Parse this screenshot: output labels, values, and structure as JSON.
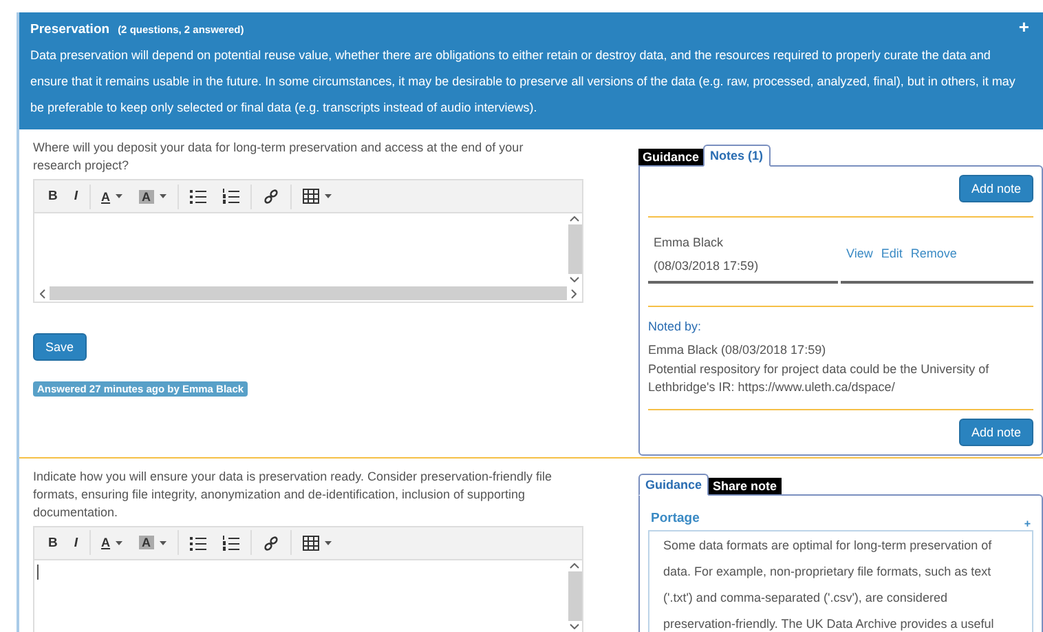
{
  "section": {
    "title": "Preservation",
    "subtitle": "(2 questions, 2 answered)",
    "expander": "+",
    "description": "Data preservation will depend on potential reuse value, whether there are obligations to either retain or destroy data, and the resources required to properly curate the data and ensure that it remains usable in the future. In some circumstances, it may be desirable to preserve all versions of the data (e.g. raw, processed, analyzed, final), but in others, it may be preferable to keep only selected or final data (e.g. transcripts instead of audio interviews)."
  },
  "questions": [
    {
      "text": "Where will you deposit your data for long-term preservation and access at the end of your research project?",
      "editor": {
        "cursor": false,
        "toolbar": [
          {
            "kind": "bold",
            "label": "B"
          },
          {
            "kind": "italic",
            "label": "I"
          },
          {
            "kind": "text-color",
            "label": "A"
          },
          {
            "kind": "highlight",
            "label": "A"
          },
          {
            "kind": "bullets"
          },
          {
            "kind": "numbers"
          },
          {
            "kind": "link"
          },
          {
            "kind": "table"
          }
        ]
      },
      "save_button": "Save",
      "status": "Answered 27 minutes ago by Emma Black",
      "tabs": [
        {
          "label": "Guidance",
          "selected": false
        },
        {
          "label": "Notes (1)",
          "selected": true
        }
      ],
      "panel": {
        "kind": "notes",
        "add_note": "Add note",
        "notes": [
          {
            "author": "Emma Black",
            "date": "(08/03/2018 17:59)",
            "actions": [
              "View",
              "Edit",
              "Remove"
            ]
          }
        ],
        "noted_by": "Noted by:",
        "detail_author": "Emma Black (08/03/2018 17:59)",
        "detail_text": "Potential respository for project data could be the University of Lethbridge's IR: https://www.uleth.ca/dspace/",
        "add_note_bottom": "Add note"
      }
    },
    {
      "text": "Indicate how you will ensure your data is preservation ready. Consider preservation-friendly file formats, ensuring file integrity, anonymization and de-identification, inclusion of supporting documentation.",
      "editor": {
        "cursor": true,
        "toolbar": [
          {
            "kind": "bold",
            "label": "B"
          },
          {
            "kind": "italic",
            "label": "I"
          },
          {
            "kind": "text-color",
            "label": "A"
          },
          {
            "kind": "highlight",
            "label": "A"
          },
          {
            "kind": "bullets"
          },
          {
            "kind": "numbers"
          },
          {
            "kind": "link"
          },
          {
            "kind": "table"
          }
        ]
      },
      "tabs": [
        {
          "label": "Guidance",
          "selected": true
        },
        {
          "label": "Share note",
          "selected": false
        }
      ],
      "panel": {
        "kind": "guidance",
        "heading": "Portage",
        "expander": "+",
        "text": "Some data formats are optimal for long-term preservation of data. For example, non-proprietary file formats, such as text ('.txt') and comma-separated ('.csv'), are considered preservation-friendly. The UK Data Archive provides a useful"
      }
    }
  ]
}
